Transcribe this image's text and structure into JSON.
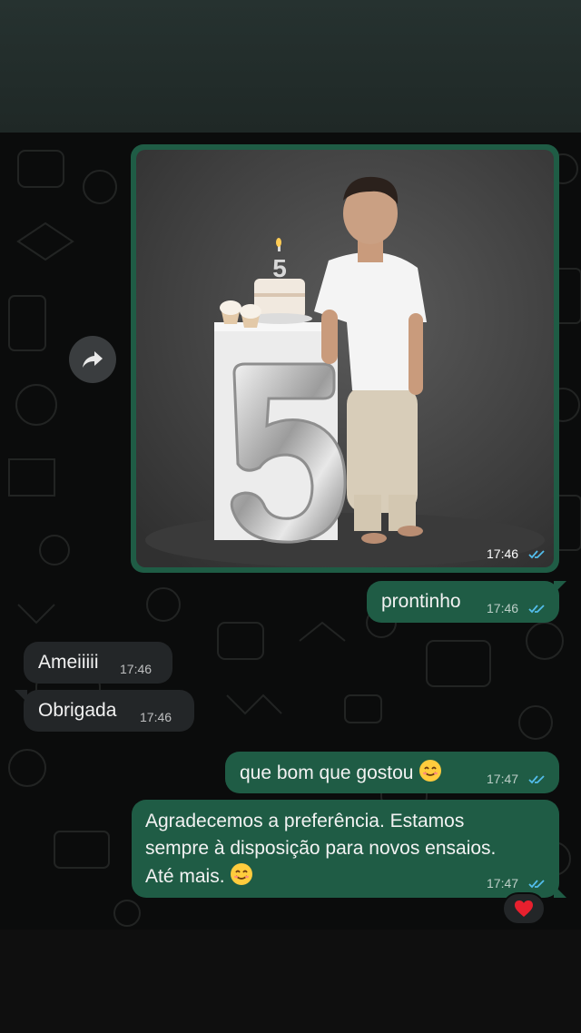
{
  "photo": {
    "alt": "Foto do ensaio",
    "cake_number": "5",
    "balloon_number": "5",
    "time": "17:46"
  },
  "messages": [
    {
      "text": "prontinho",
      "time": "17:46",
      "direction": "out"
    },
    {
      "text": "Ameiiiii",
      "time": "17:46",
      "direction": "in"
    },
    {
      "text": "Obrigada",
      "time": "17:46",
      "direction": "in"
    },
    {
      "text": "que bom que gostou",
      "emoji": "smiling-face",
      "time": "17:47",
      "direction": "out"
    },
    {
      "lines": [
        "Agradecemos a preferência. Estamos",
        "sempre à disposição para novos ensaios.",
        "Até mais."
      ],
      "emoji": "smiling-face",
      "time": "17:47",
      "direction": "out"
    }
  ],
  "reaction": {
    "icon": "red-heart"
  },
  "colors": {
    "outgoing_bubble": "#1f5c45",
    "incoming_bubble": "#232628",
    "read_ticks": "#53bdeb",
    "background": "#0b0c0c"
  },
  "icons": {
    "forward": "forward-arrow-icon",
    "read": "double-check-icon"
  }
}
